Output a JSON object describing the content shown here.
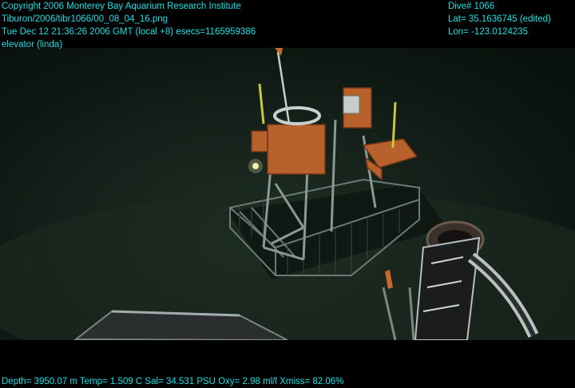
{
  "header_left": {
    "line1": "Copyright 2006 Monterey Bay Aquarium Research Institute",
    "line2": "Tiburon/2006/tibr1066/00_08_04_16.png",
    "line3": "Tue Dec 12 21:36:26 2006 GMT (local +8)  esecs=1165959386",
    "line4": "elevator (linda)"
  },
  "header_right": {
    "line1": "Dive# 1066",
    "line2": "Lat= 35.1636745 (edited)",
    "line3": "Lon= -123.0124235"
  },
  "footer": {
    "telemetry": "Depth= 3950.07 m  Temp= 1.509 C  Sal= 34.531 PSU  Oxy= 2.98 ml/l  Xmiss= 82.06%"
  },
  "colors": {
    "overlay_text": "#18e0e6",
    "background": "#000000",
    "seafloor": "#142019",
    "float_orange": "#b8612c"
  }
}
